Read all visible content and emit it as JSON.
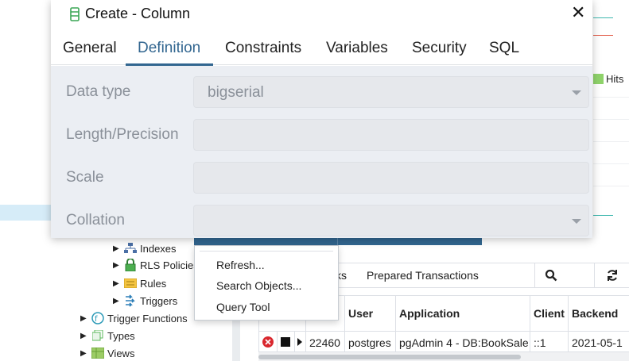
{
  "dialog": {
    "title": "Create - Column",
    "close_glyph": "✕",
    "tabs": [
      "General",
      "Definition",
      "Constraints",
      "Variables",
      "Security",
      "SQL"
    ],
    "active_tab": "Definition",
    "fields": [
      {
        "label": "Data type",
        "value": "bigserial",
        "type": "select"
      },
      {
        "label": "Length/Precision",
        "value": "",
        "type": "text"
      },
      {
        "label": "Scale",
        "value": "",
        "type": "text"
      },
      {
        "label": "Collation",
        "value": "",
        "type": "select"
      }
    ]
  },
  "tree": {
    "items": [
      {
        "label": "Indexes",
        "icon": "indexes-icon"
      },
      {
        "label": "RLS Policies",
        "icon": "rls-policies-icon"
      },
      {
        "label": "Rules",
        "icon": "rules-icon"
      },
      {
        "label": "Triggers",
        "icon": "triggers-icon"
      },
      {
        "label": "Trigger Functions",
        "icon": "trigger-functions-icon"
      },
      {
        "label": "Types",
        "icon": "types-icon"
      },
      {
        "label": "Views",
        "icon": "views-icon"
      }
    ]
  },
  "context_menu": {
    "items": [
      "Refresh...",
      "Search Objects...",
      "Query Tool"
    ]
  },
  "chart_legend": {
    "label": "Hits",
    "color": "#8fd36b"
  },
  "dashboard": {
    "tabs_partial": "ks",
    "tab_prepared": "Prepared Transactions",
    "columns": [
      "User",
      "Application",
      "Client",
      "Backend"
    ],
    "row": {
      "pid": "22460",
      "user": "postgres",
      "application": "pgAdmin 4 - DB:BookSale",
      "client": "::1",
      "backend": "2021-05-1"
    }
  },
  "colors": {
    "accent": "#326690",
    "dialog_body": "#ebeef3",
    "selected_tree": "#d6ecf8"
  }
}
